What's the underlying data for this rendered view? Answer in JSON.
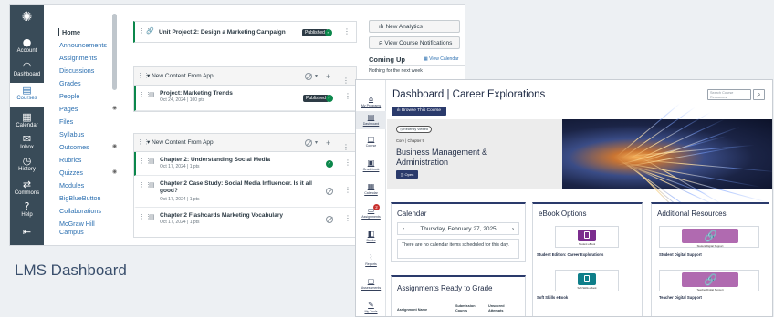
{
  "lms": {
    "global_nav": [
      {
        "label": "",
        "icon": "canvas-logo-icon"
      },
      {
        "label": "Account",
        "icon": "account-icon"
      },
      {
        "label": "Dashboard",
        "icon": "dashboard-icon"
      },
      {
        "label": "Courses",
        "icon": "courses-icon"
      },
      {
        "label": "Calendar",
        "icon": "calendar-icon"
      },
      {
        "label": "Inbox",
        "icon": "inbox-icon"
      },
      {
        "label": "History",
        "icon": "history-icon"
      },
      {
        "label": "Commons",
        "icon": "commons-icon"
      },
      {
        "label": "Help",
        "icon": "help-icon"
      }
    ],
    "course_nav": [
      "Home",
      "Announcements",
      "Assignments",
      "Discussions",
      "Grades",
      "People",
      "Pages",
      "Files",
      "Syllabus",
      "Outcomes",
      "Rubrics",
      "Quizzes",
      "Modules",
      "BigBlueButton",
      "Collaborations",
      "McGraw Hill Campus"
    ],
    "top_item": {
      "title": "Unit Project 2: Design a Marketing Campaign",
      "status": "Published"
    },
    "module1": {
      "header": "New Content From App",
      "items": [
        {
          "title": "Project: Marketing Trends",
          "date": "Oct 24, 2024 | 100 pts",
          "status": "Published"
        }
      ]
    },
    "module2": {
      "header": "New Content From App",
      "items": [
        {
          "title": "Chapter 2: Understanding Social Media",
          "date": "Oct 17, 2024 | 1 pts"
        },
        {
          "title": "Chapter 2 Case Study: Social Media Influencer. Is it all good?",
          "date": "Oct 17, 2024 | 1 pts"
        },
        {
          "title": "Chapter 2 Flashcards Marketing Vocabulary",
          "date": "Oct 17, 2024 | 1 pts"
        }
      ]
    },
    "sidebar": {
      "new_analytics": "New Analytics",
      "notifications": "View Course Notifications",
      "coming_up": "Coming Up",
      "view_calendar": "View Calendar",
      "nothing": "Nothing for the next week"
    }
  },
  "caption": "LMS Dashboard",
  "dash": {
    "nav": [
      {
        "label": "My Programs",
        "icon": "home-icon"
      },
      {
        "label": "Dashboard",
        "icon": "dashboard-icon"
      },
      {
        "label": "Course",
        "icon": "course-icon"
      },
      {
        "label": "Gradebook",
        "icon": "gradebook-icon"
      },
      {
        "label": "Calendar",
        "icon": "calendar-icon"
      },
      {
        "label": "Assignments",
        "icon": "assignments-icon",
        "badge": "2"
      },
      {
        "label": "Books",
        "icon": "books-icon"
      },
      {
        "label": "Reports",
        "icon": "reports-icon"
      },
      {
        "label": "Assessments",
        "icon": "assessments-icon"
      },
      {
        "label": "My Tools",
        "icon": "tools-icon"
      }
    ],
    "title": "Dashboard | Career Explorations",
    "search_placeholder": "Search Course Resources",
    "browse": "Browse This Course",
    "hero": {
      "recently_viewed": "Recently Viewed",
      "crumb": "Core | Chapter 9",
      "title": "Business Management & Administration",
      "open": "Open"
    },
    "calendar": {
      "title": "Calendar",
      "date": "Thursday, February 27, 2025",
      "empty": "There are no calendar items scheduled for this day."
    },
    "ebook": {
      "title": "eBook Options",
      "items": [
        {
          "tile_caption": "Student eBook",
          "label": "Student Edition: Career Explorations"
        },
        {
          "tile_caption": "Soft Skills eBook",
          "label": "Soft Skills eBook"
        }
      ]
    },
    "resources": {
      "title": "Additional Resources",
      "items": [
        {
          "tile_caption": "Student Digital Support",
          "label": "Student Digital Support"
        },
        {
          "tile_caption": "Teacher Digital Support",
          "label": "Teacher Digital Support"
        }
      ]
    },
    "grading": {
      "title": "Assignments Ready to Grade",
      "columns": [
        "Assignment Name",
        "Submission Counts",
        "Unscored Attempts"
      ]
    }
  },
  "colors": {
    "lms_nav": "#394b58",
    "published": "#0b874b",
    "dash_primary": "#2a3a6b",
    "ebook_tile": "#7b2d8e",
    "resource_tile": "#b06ab0"
  }
}
